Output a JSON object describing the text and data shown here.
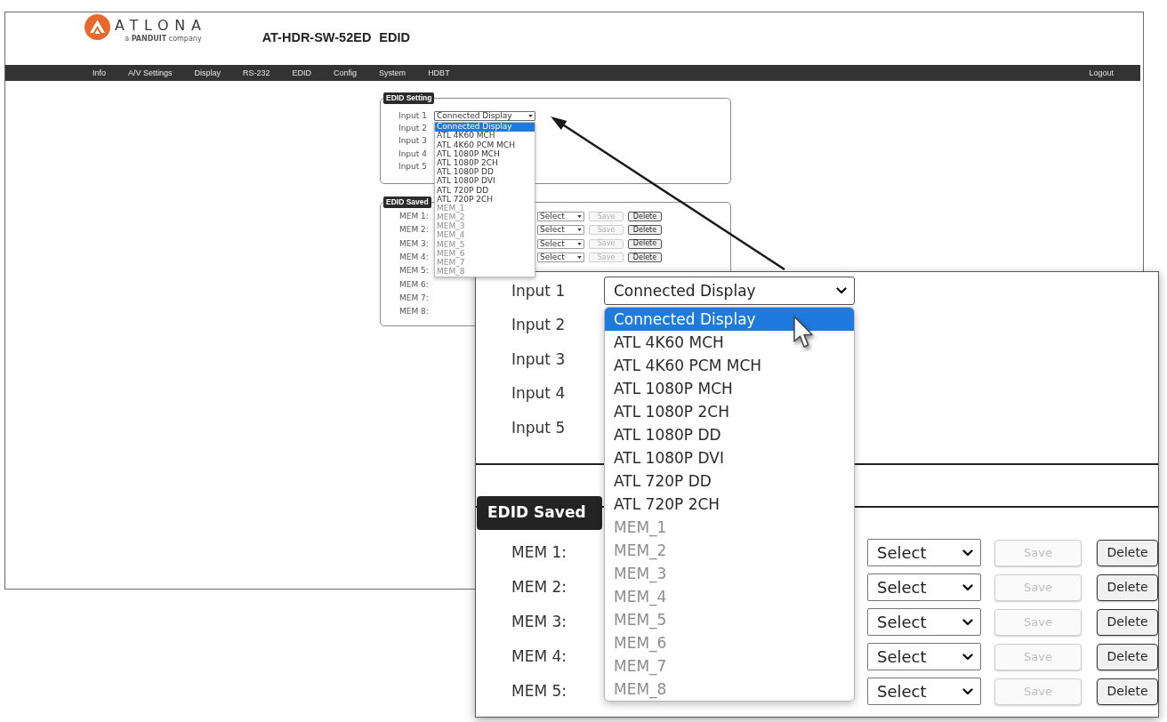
{
  "header": {
    "logo": {
      "wordmark": "ATLONA",
      "tagline": "a **PANDUIT** company"
    },
    "model": "AT-HDR-SW-52ED",
    "page": "EDID"
  },
  "nav": {
    "items": [
      {
        "label": "Info",
        "selected": false
      },
      {
        "label": "A/V Settings",
        "selected": false
      },
      {
        "label": "Display",
        "selected": false
      },
      {
        "label": "RS-232",
        "selected": false
      },
      {
        "label": "EDID",
        "selected": false
      },
      {
        "label": "Config",
        "selected": false
      },
      {
        "label": "System",
        "selected": false
      },
      {
        "label": "HDBT",
        "selected": false
      }
    ],
    "logout": "Logout"
  },
  "edid_setting": {
    "legend": "EDID Setting",
    "inputs": [
      {
        "label": "Input 1",
        "value": "Connected Display",
        "open": true
      },
      {
        "label": "Input 2"
      },
      {
        "label": "Input 3"
      },
      {
        "label": "Input 4"
      },
      {
        "label": "Input 5"
      }
    ],
    "options": [
      {
        "label": "Connected Display",
        "selected": true,
        "disabled": false
      },
      {
        "label": "ATL 4K60 MCH",
        "selected": false,
        "disabled": false
      },
      {
        "label": "ATL 4K60 PCM MCH",
        "selected": false,
        "disabled": false
      },
      {
        "label": "ATL 1080P MCH",
        "selected": false,
        "disabled": false
      },
      {
        "label": "ATL 1080P 2CH",
        "selected": false,
        "disabled": false
      },
      {
        "label": "ATL 1080P DD",
        "selected": false,
        "disabled": false
      },
      {
        "label": "ATL 1080P DVI",
        "selected": false,
        "disabled": false
      },
      {
        "label": "ATL 720P DD",
        "selected": false,
        "disabled": false
      },
      {
        "label": "ATL 720P 2CH",
        "selected": false,
        "disabled": false
      },
      {
        "label": "MEM_1",
        "selected": false,
        "disabled": true
      },
      {
        "label": "MEM_2",
        "selected": false,
        "disabled": true
      },
      {
        "label": "MEM_3",
        "selected": false,
        "disabled": true
      },
      {
        "label": "MEM_4",
        "selected": false,
        "disabled": true
      },
      {
        "label": "MEM_5",
        "selected": false,
        "disabled": true
      },
      {
        "label": "MEM_6",
        "selected": false,
        "disabled": true
      },
      {
        "label": "MEM_7",
        "selected": false,
        "disabled": true
      },
      {
        "label": "MEM_8",
        "selected": false,
        "disabled": true
      }
    ]
  },
  "edid_saved": {
    "legend": "EDID Saved",
    "rows": [
      {
        "label": "MEM 1:",
        "select": "Select",
        "save": {
          "label": "Save",
          "disabled": true
        },
        "delete": {
          "label": "Delete",
          "disabled": false
        }
      },
      {
        "label": "MEM 2:",
        "select": "Select",
        "save": {
          "label": "Save",
          "disabled": true
        },
        "delete": {
          "label": "Delete",
          "disabled": false
        }
      },
      {
        "label": "MEM 3:",
        "select": "Select",
        "save": {
          "label": "Save",
          "disabled": true
        },
        "delete": {
          "label": "Delete",
          "disabled": false
        }
      },
      {
        "label": "MEM 4:",
        "select": "Select",
        "save": {
          "label": "Save",
          "disabled": true
        },
        "delete": {
          "label": "Delete",
          "disabled": false
        }
      },
      {
        "label": "MEM 5:"
      },
      {
        "label": "MEM 6:"
      },
      {
        "label": "MEM 7:"
      },
      {
        "label": "MEM 8:"
      }
    ]
  },
  "magnified_view": {
    "edid_setting": {
      "inputs": [
        {
          "label": "Input 1",
          "value": "Connected Display",
          "open": true
        },
        {
          "label": "Input 2"
        },
        {
          "label": "Input 3"
        },
        {
          "label": "Input 4"
        },
        {
          "label": "Input 5"
        }
      ],
      "options": [
        {
          "label": "Connected Display",
          "selected": true,
          "disabled": false
        },
        {
          "label": "ATL 4K60 MCH",
          "selected": false,
          "disabled": false
        },
        {
          "label": "ATL 4K60 PCM MCH",
          "selected": false,
          "disabled": false
        },
        {
          "label": "ATL 1080P MCH",
          "selected": false,
          "disabled": false
        },
        {
          "label": "ATL 1080P 2CH",
          "selected": false,
          "disabled": false
        },
        {
          "label": "ATL 1080P DD",
          "selected": false,
          "disabled": false
        },
        {
          "label": "ATL 1080P DVI",
          "selected": false,
          "disabled": false
        },
        {
          "label": "ATL 720P DD",
          "selected": false,
          "disabled": false
        },
        {
          "label": "ATL 720P 2CH",
          "selected": false,
          "disabled": false
        },
        {
          "label": "MEM_1",
          "selected": false,
          "disabled": true
        },
        {
          "label": "MEM_2",
          "selected": false,
          "disabled": true
        },
        {
          "label": "MEM_3",
          "selected": false,
          "disabled": true
        },
        {
          "label": "MEM_4",
          "selected": false,
          "disabled": true
        },
        {
          "label": "MEM_5",
          "selected": false,
          "disabled": true
        },
        {
          "label": "MEM_6",
          "selected": false,
          "disabled": true
        },
        {
          "label": "MEM_7",
          "selected": false,
          "disabled": true
        },
        {
          "label": "MEM_8",
          "selected": false,
          "disabled": true
        }
      ]
    },
    "edid_saved": {
      "legend": "EDID Saved",
      "rows": [
        {
          "label": "MEM 1:",
          "select": "Select",
          "save": {
            "label": "Save",
            "disabled": true
          },
          "delete": {
            "label": "Delete",
            "disabled": false
          }
        },
        {
          "label": "MEM 2:",
          "select": "Select",
          "save": {
            "label": "Save",
            "disabled": true
          },
          "delete": {
            "label": "Delete",
            "disabled": false
          }
        },
        {
          "label": "MEM 3:",
          "select": "Select",
          "save": {
            "label": "Save",
            "disabled": true
          },
          "delete": {
            "label": "Delete",
            "disabled": false
          }
        },
        {
          "label": "MEM 4:",
          "select": "Select",
          "save": {
            "label": "Save",
            "disabled": true
          },
          "delete": {
            "label": "Delete",
            "disabled": false
          }
        },
        {
          "label": "MEM 5:",
          "select": "Select",
          "save": {
            "label": "Save",
            "disabled": true
          },
          "delete": {
            "label": "Delete",
            "disabled": false
          }
        }
      ]
    }
  }
}
